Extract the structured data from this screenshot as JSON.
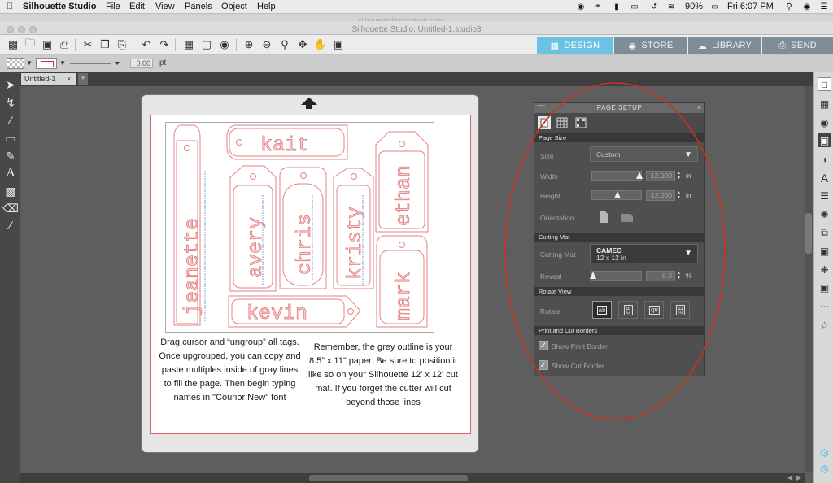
{
  "menubar": {
    "apple": "",
    "app_name": "Silhouette Studio",
    "menus": [
      "File",
      "Edit",
      "View",
      "Panels",
      "Object",
      "Help"
    ],
    "battery": "90%",
    "clock": "Fri 6:07 PM"
  },
  "window": {
    "title": "Silhouette Studio: Untitled-1.studio3",
    "ghost_url": "silhouettedesignstore.com"
  },
  "nav": {
    "design": "DESIGN",
    "store": "STORE",
    "library": "LIBRARY",
    "send": "SEND"
  },
  "stylebar": {
    "line_width": "0.00",
    "line_unit": "pt"
  },
  "document": {
    "tab_label": "Untitled-1",
    "close": "×",
    "add": "+"
  },
  "canvas": {
    "tags": [
      "jeanette",
      "kait",
      "avery",
      "chris",
      "kristy",
      "ethan",
      "mark",
      "kevin"
    ],
    "note_left": "Drag cursor and “ungroup” all tags. Once upgrouped, you can copy and paste multiples inside of gray lines to fill the page. Then begin typing names in \"Courior New\" font",
    "note_right": "Remember, the grey outline is your 8.5” x 11” paper. Be sure to position it like so on your Silhouette 12' x 12' cut mat. If you forget the cutter will cut beyond those lines"
  },
  "page_setup": {
    "title": "PAGE SETUP",
    "close": "×",
    "sections": {
      "page_size": "Page Size",
      "cutting_mat": "Cutting Mat",
      "rotate_view": "Rotate View",
      "borders": "Print and Cut Borders"
    },
    "size_label": "Size",
    "size_value": "Custom",
    "width_label": "Width",
    "width_value": "12.000",
    "height_label": "Height",
    "height_value": "12.000",
    "unit": "in",
    "orientation_label": "Orientation",
    "cutting_mat_label": "Cutting Mat",
    "cutting_mat_name": "CAMEO",
    "cutting_mat_size": "12 x 12 in",
    "reveal_label": "Reveal",
    "reveal_value": "0.0",
    "reveal_unit": "%",
    "rotate_label": "Rotate",
    "rotate_options": [
      "ab",
      "ab",
      "ab",
      "ab"
    ],
    "show_print_border": "Show Print Border",
    "show_cut_border": "Show Cut Border"
  },
  "colors": {
    "accent_design": "#6cc2e3",
    "nav_inactive": "#7d8d99",
    "tag_outline": "#e07070",
    "annotation": "#c8321e"
  }
}
